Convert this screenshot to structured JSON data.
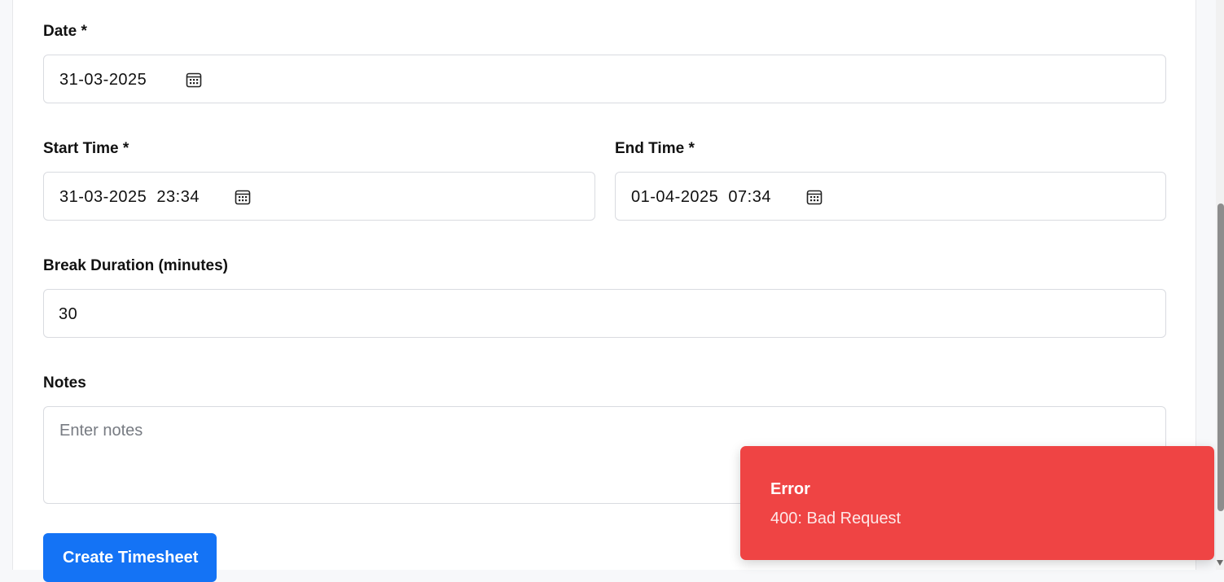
{
  "form": {
    "date": {
      "label": "Date *",
      "value": "31-03-2025"
    },
    "start_time": {
      "label": "Start Time *",
      "value": "31-03-2025  23:34"
    },
    "end_time": {
      "label": "End Time *",
      "value": "01-04-2025  07:34"
    },
    "break_duration": {
      "label": "Break Duration (minutes)",
      "value": "30"
    },
    "notes": {
      "label": "Notes",
      "placeholder": "Enter notes",
      "value": ""
    },
    "submit_label": "Create Timesheet"
  },
  "toast": {
    "title": "Error",
    "message": "400: Bad Request",
    "color": "#ef4444"
  },
  "colors": {
    "primary": "#1473f5",
    "error": "#ef4444"
  },
  "icons": {
    "date_picker": "calendar-icon"
  }
}
